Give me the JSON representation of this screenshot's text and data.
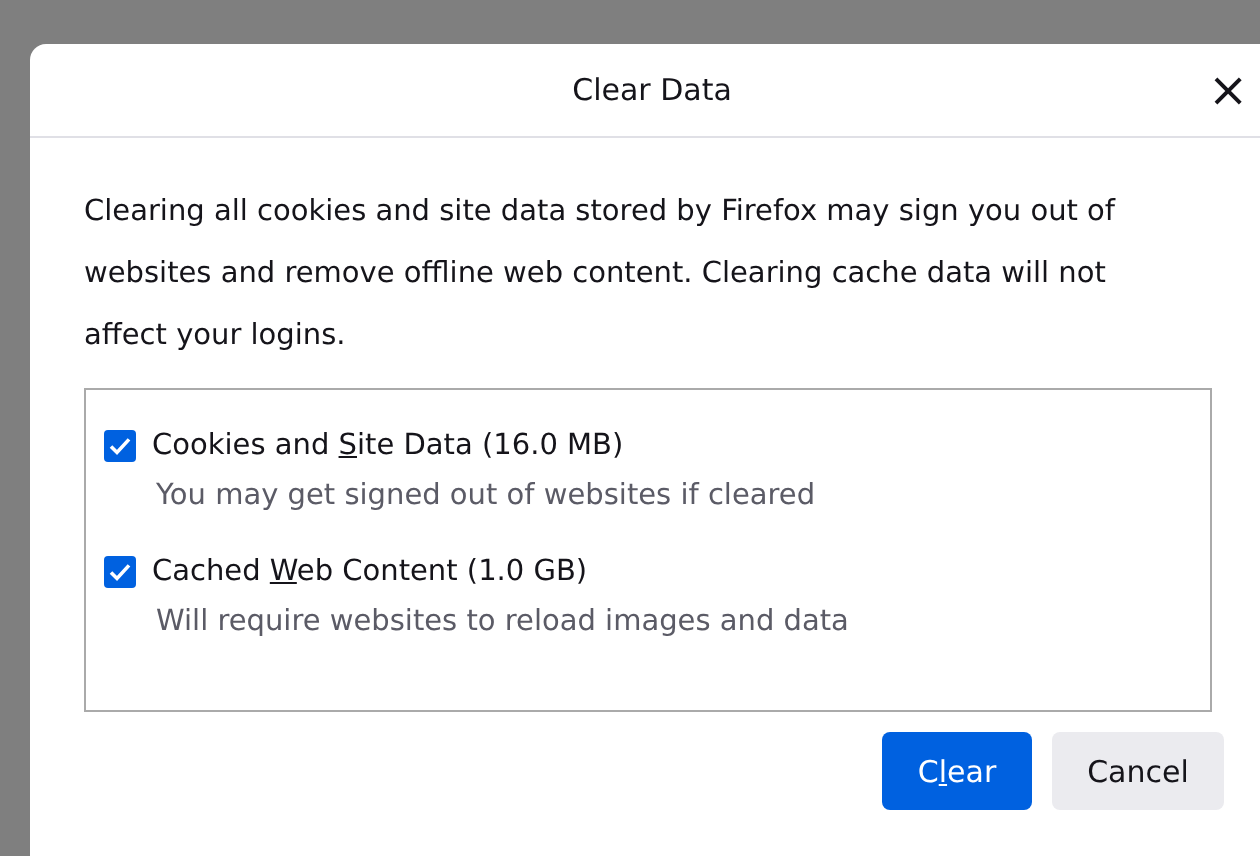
{
  "dialog": {
    "title": "Clear Data",
    "close": "×"
  },
  "description": "Clearing all cookies and site data stored by Firefox may sign you out of websites and remove offline web content. Clearing cache data will not affect your logins.",
  "options": [
    {
      "label_before": "Cookies and ",
      "access_key": "S",
      "label_after": "ite Data (16.0 MB)",
      "hint": "You may get signed out of websites if cleared",
      "checked": true
    },
    {
      "label_before": "Cached ",
      "access_key": "W",
      "label_after": "eb Content (1.0 GB)",
      "hint": "Will require websites to reload images and data",
      "checked": true
    }
  ],
  "buttons": [
    {
      "label_before": "C",
      "access_key": "l",
      "label_after": "ear",
      "kind": "primary"
    },
    {
      "label_before": "Cancel",
      "kind": "secondary"
    }
  ]
}
